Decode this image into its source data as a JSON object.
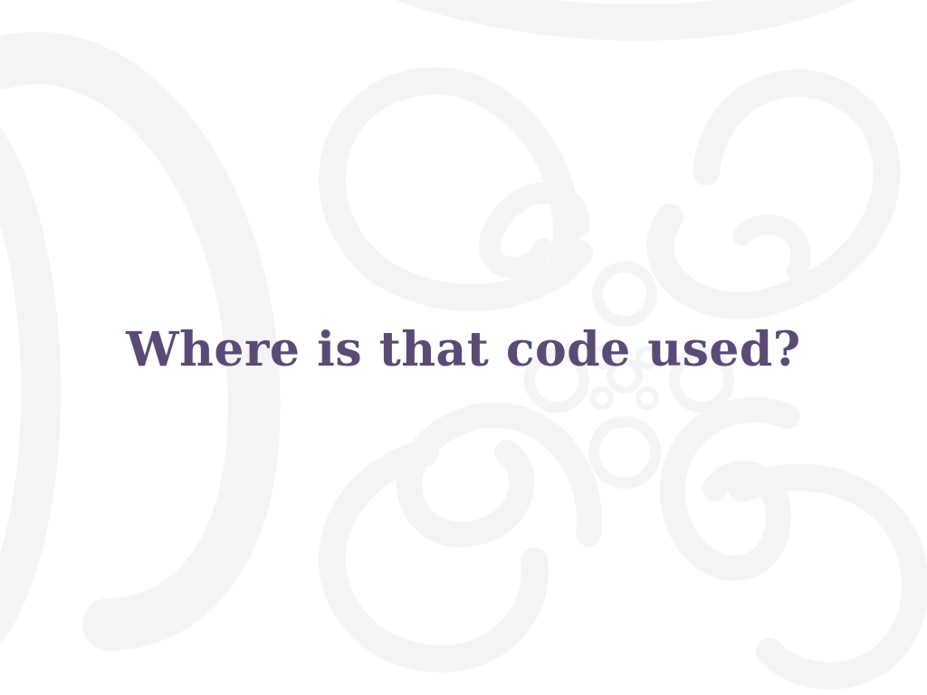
{
  "slide": {
    "title": "Where is that code used?"
  },
  "colors": {
    "title_text": "#5b4a75",
    "background": "#ffffff",
    "ornament": "#f4f4f6"
  },
  "background": {
    "ornament_icon": "decorative-swirl-ornament"
  }
}
